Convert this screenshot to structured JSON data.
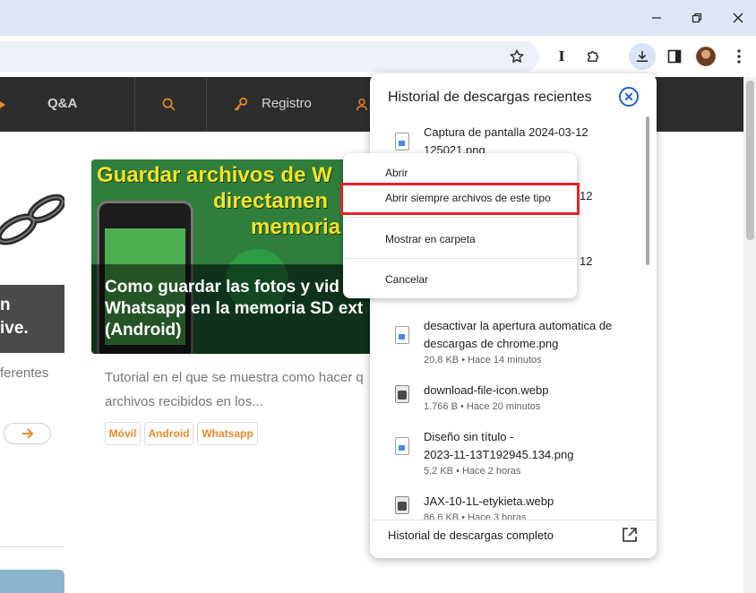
{
  "window": {
    "minimize_icon": "minimize-icon",
    "restore_icon": "restore-icon",
    "close_icon": "close-icon"
  },
  "toolbar": {
    "icons": [
      "star-icon",
      "text-cursor-icon",
      "extensions-icon",
      "download-icon",
      "sidepanel-icon",
      "profile-avatar",
      "more-icon"
    ]
  },
  "site": {
    "nav": {
      "qa": "Q&A",
      "register": "Registro"
    },
    "left_card": {
      "caption_line1": "n",
      "caption_line2": "ive.",
      "excerpt": "ferentes"
    },
    "main_card": {
      "image_line1": "Guardar archivos de W",
      "image_line2": "directamen",
      "image_line3": "memoria",
      "title_line1": "Como guardar las fotos y vid",
      "title_line2": "Whatsapp en la memoria SD ext",
      "title_line3": "(Android)",
      "excerpt_line1": "Tutorial en el que se muestra como hacer q",
      "excerpt_line2": "archivos recibidos en los...",
      "tags": [
        "Móvil",
        "Android",
        "Whatsapp"
      ]
    }
  },
  "downloads": {
    "title": "Historial de descargas recientes",
    "footer": "Historial de descargas completo",
    "items": [
      {
        "name_line1": "Captura de pantalla 2024-03-12",
        "name_line2": "125021.png",
        "meta": ""
      },
      {
        "name_line1": "12",
        "name_line2": "",
        "meta": ""
      },
      {
        "name_line1": "12",
        "name_line2": "",
        "meta": ""
      },
      {
        "name_line1": "desactivar la apertura automatica de",
        "name_line2": "descargas de chrome.png",
        "meta": "20,8 KB • Hace 14 minutos"
      },
      {
        "name_line1": "download-file-icon.webp",
        "name_line2": "",
        "meta": "1.766 B • Hace 20 minutos"
      },
      {
        "name_line1": "Diseño sin título -",
        "name_line2": "2023-11-13T192945.134.png",
        "meta": "5,2 KB • Hace 2 horas"
      },
      {
        "name_line1": "JAX-10-1L-etykieta.webp",
        "name_line2": "",
        "meta": "86,6 KB • Hace 3 horas"
      }
    ]
  },
  "context_menu": {
    "open": "Abrir",
    "always_open": "Abrir siempre archivos de este tipo",
    "show_in_folder": "Mostrar en carpeta",
    "cancel": "Cancelar"
  },
  "colors": {
    "accent": "#1a62d6",
    "highlight": "#e3222a",
    "site_nav": "#2d2d2d",
    "brand_orange": "#e8892b"
  }
}
